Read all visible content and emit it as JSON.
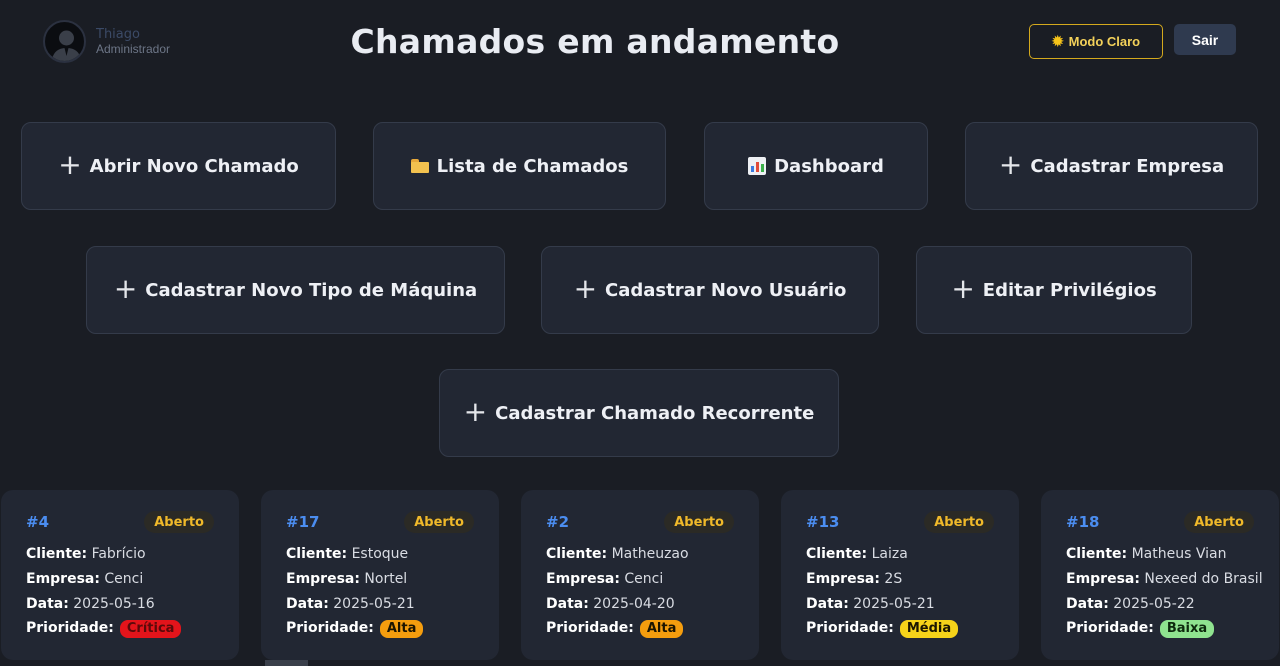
{
  "user": {
    "name": "Thiago",
    "role": "Administrador"
  },
  "header": {
    "title": "Chamados em andamento",
    "theme_button": "Modo Claro",
    "exit_button": "Sair"
  },
  "actions": [
    {
      "label": "Abrir Novo Chamado",
      "icon": "plus-icon"
    },
    {
      "label": "Lista de Chamados",
      "icon": "folder-icon"
    },
    {
      "label": "Dashboard",
      "icon": "bar-chart-icon"
    },
    {
      "label": "Cadastrar Empresa",
      "icon": "plus-icon"
    },
    {
      "label": "Cadastrar Novo Tipo de Máquina",
      "icon": "plus-icon"
    },
    {
      "label": "Cadastrar Novo Usuário",
      "icon": "plus-icon"
    },
    {
      "label": "Editar Privilégios",
      "icon": "plus-icon"
    },
    {
      "label": "Cadastrar Chamado Recorrente",
      "icon": "plus-icon"
    }
  ],
  "labels": {
    "cliente": "Cliente:",
    "empresa": "Empresa:",
    "data": "Data:",
    "prioridade": "Prioridade:"
  },
  "tickets": [
    {
      "id": "#4",
      "status": "Aberto",
      "cliente": "Fabrício",
      "empresa": "Cenci",
      "data": "2025-05-16",
      "prioridade": "Crítica",
      "prio_bg": "#e3141b",
      "prio_fg": "#5a0a0a"
    },
    {
      "id": "#17",
      "status": "Aberto",
      "cliente": "Estoque",
      "empresa": "Nortel",
      "data": "2025-05-21",
      "prioridade": "Alta",
      "prio_bg": "#f59d0e",
      "prio_fg": "#1c1400"
    },
    {
      "id": "#2",
      "status": "Aberto",
      "cliente": "Matheuzao",
      "empresa": "Cenci",
      "data": "2025-04-20",
      "prioridade": "Alta",
      "prio_bg": "#f59d0e",
      "prio_fg": "#1c1400"
    },
    {
      "id": "#13",
      "status": "Aberto",
      "cliente": "Laiza",
      "empresa": "2S",
      "data": "2025-05-21",
      "prioridade": "Média",
      "prio_bg": "#f6d31a",
      "prio_fg": "#1c1600"
    },
    {
      "id": "#18",
      "status": "Aberto",
      "cliente": "Matheus Vian",
      "empresa": "Nexeed do Brasil",
      "data": "2025-05-22",
      "prioridade": "Baixa",
      "prio_bg": "#8fe38f",
      "prio_fg": "#0d2a0d"
    }
  ]
}
